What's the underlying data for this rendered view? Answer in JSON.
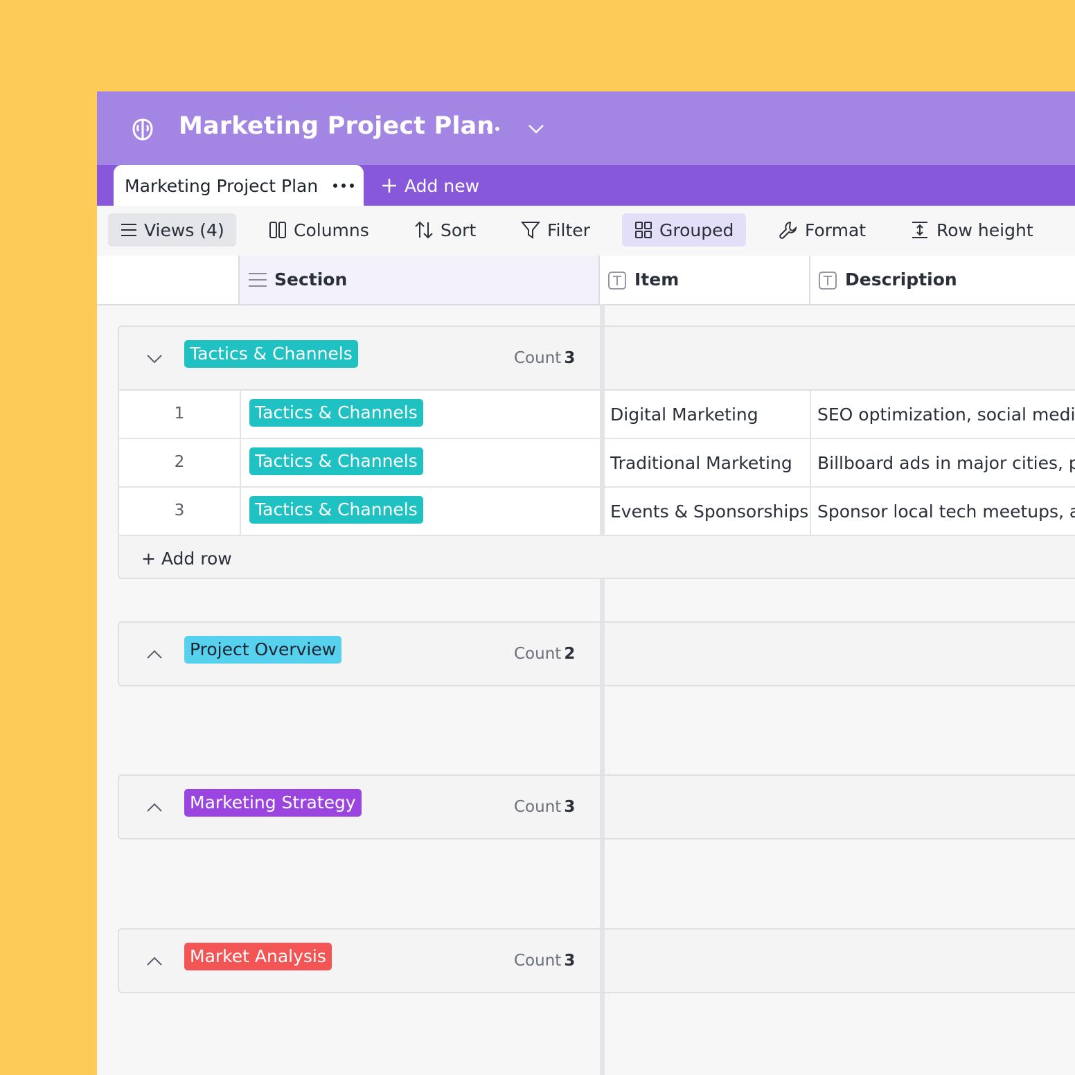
{
  "header": {
    "title": "Marketing Project Plan",
    "logo_icon": "brain-icon",
    "more_icon": "more-horizontal-icon",
    "dropdown_icon": "chevron-down-icon"
  },
  "tabs": {
    "active_label": "Marketing Project Plan",
    "add_new_label": "Add new"
  },
  "toolbar": {
    "views": "Views (4)",
    "columns": "Columns",
    "sort": "Sort",
    "filter": "Filter",
    "grouped": "Grouped",
    "format": "Format",
    "row_height": "Row height"
  },
  "columns": {
    "section": "Section",
    "item": "Item",
    "description": "Description"
  },
  "groups": [
    {
      "label": "Tactics & Channels",
      "color": "#1FC1C3",
      "text_color": "#ffffff",
      "count_label": "Count",
      "count": "3",
      "expanded": true,
      "rows": [
        {
          "num": "1",
          "section": "Tactics & Channels",
          "item": "Digital Marketing",
          "description": "SEO optimization, social media"
        },
        {
          "num": "2",
          "section": "Tactics & Channels",
          "item": "Traditional Marketing",
          "description": "Billboard ads in major cities, pri"
        },
        {
          "num": "3",
          "section": "Tactics & Channels",
          "item": "Events & Sponsorships",
          "description": "Sponsor local tech meetups, at"
        }
      ],
      "add_row_label": "+ Add row"
    },
    {
      "label": "Project Overview",
      "color": "#56D2EE",
      "text_color": "#1f2330",
      "count_label": "Count",
      "count": "2",
      "expanded": false
    },
    {
      "label": "Marketing Strategy",
      "color": "#9A45E0",
      "text_color": "#ffffff",
      "count_label": "Count",
      "count": "3",
      "expanded": false
    },
    {
      "label": "Market Analysis",
      "color": "#F35454",
      "text_color": "#ffffff",
      "count_label": "Count",
      "count": "3",
      "expanded": false
    }
  ]
}
